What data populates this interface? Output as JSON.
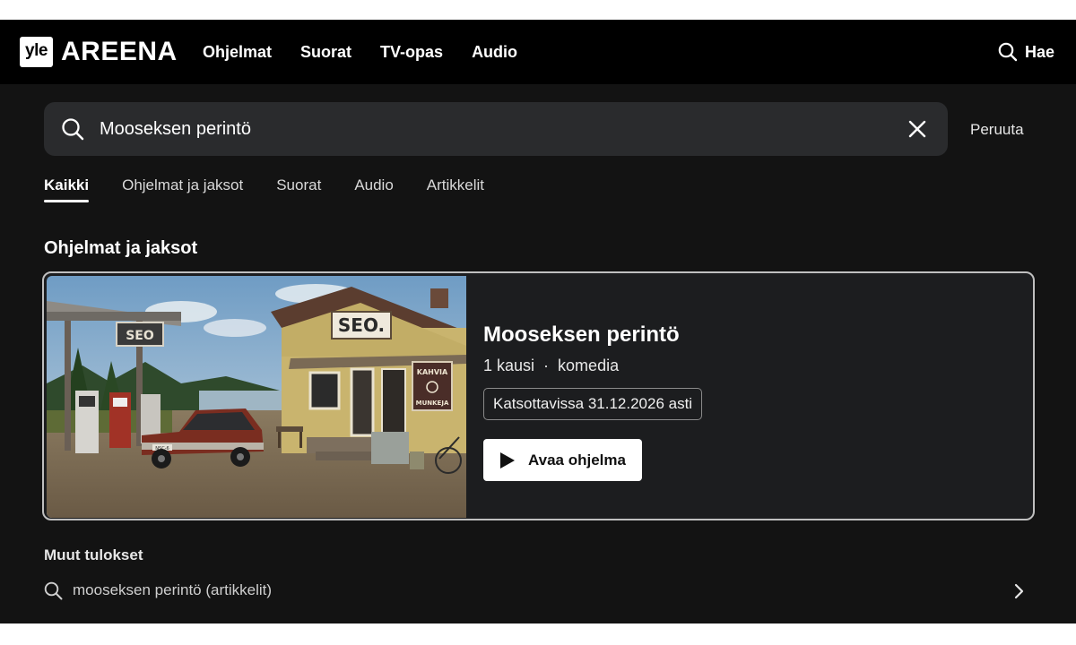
{
  "header": {
    "logo_mark": "yle",
    "logo_word": "AREENA",
    "nav": [
      "Ohjelmat",
      "Suorat",
      "TV-opas",
      "Audio"
    ],
    "search_label": "Hae"
  },
  "search": {
    "value": "Mooseksen perintö",
    "cancel_label": "Peruuta"
  },
  "tabs": [
    {
      "label": "Kaikki",
      "active": true
    },
    {
      "label": "Ohjelmat ja jaksot",
      "active": false
    },
    {
      "label": "Suorat",
      "active": false
    },
    {
      "label": "Audio",
      "active": false
    },
    {
      "label": "Artikkelit",
      "active": false
    }
  ],
  "section_title": "Ohjelmat ja jaksot",
  "card": {
    "title": "Mooseksen perintö",
    "seasons": "1 kausi",
    "separator": "·",
    "genre": "komedia",
    "availability": "Katsottavissa 31.12.2026 asti",
    "open_label": "Avaa ohjelma",
    "thumbnail": {
      "sign_roof": "SEO.",
      "sign_canopy": "SEO",
      "sign_side_top": "KAHVIA",
      "sign_side_bottom": "MUNKEJA",
      "plate": "NSC-6"
    }
  },
  "other_results": {
    "title": "Muut tulokset",
    "items": [
      {
        "label": "mooseksen perintö (artikkelit)"
      }
    ]
  },
  "colors": {
    "header_bg": "#000000",
    "page_bg": "#131313",
    "search_bg": "#2a2b2d",
    "card_border": "#bfbfbf",
    "button_bg": "#ffffff"
  }
}
